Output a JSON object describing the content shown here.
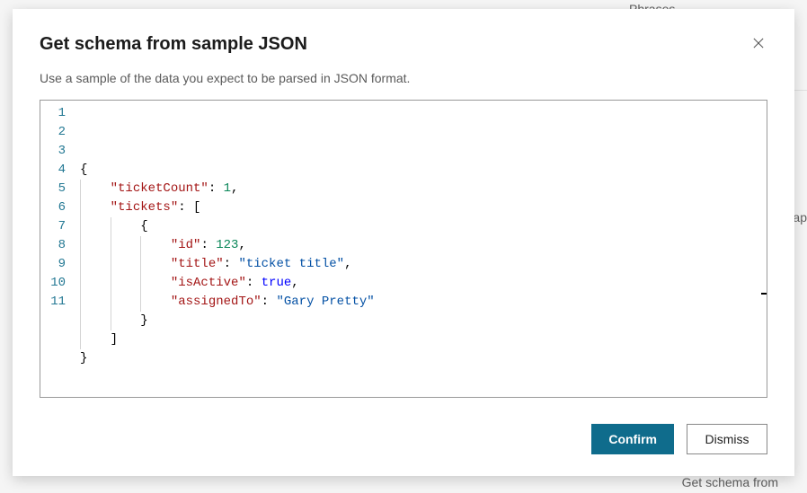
{
  "background": {
    "phrases": "Phrases",
    "ap": "ap",
    "get_schema": "Get schema from"
  },
  "dialog": {
    "title": "Get schema from sample JSON",
    "subtitle": "Use a sample of the data you expect to be parsed in JSON format.",
    "buttons": {
      "confirm": "Confirm",
      "dismiss": "Dismiss"
    }
  },
  "editor": {
    "line_count": 11,
    "sample": {
      "ticketCount": 1,
      "tickets": [
        {
          "id": 123,
          "title": "ticket title",
          "isActive": true,
          "assignedTo": "Gary Pretty"
        }
      ]
    },
    "tokens": [
      [
        {
          "t": "brace",
          "v": "{"
        }
      ],
      [
        {
          "t": "indent",
          "v": 1
        },
        {
          "t": "key",
          "v": "\"ticketCount\""
        },
        {
          "t": "colon",
          "v": ": "
        },
        {
          "t": "num",
          "v": "1"
        },
        {
          "t": "punct",
          "v": ","
        }
      ],
      [
        {
          "t": "indent",
          "v": 1
        },
        {
          "t": "key",
          "v": "\"tickets\""
        },
        {
          "t": "colon",
          "v": ": "
        },
        {
          "t": "punct",
          "v": "["
        }
      ],
      [
        {
          "t": "indent",
          "v": 2
        },
        {
          "t": "brace",
          "v": "{"
        }
      ],
      [
        {
          "t": "indent",
          "v": 3
        },
        {
          "t": "key",
          "v": "\"id\""
        },
        {
          "t": "colon",
          "v": ": "
        },
        {
          "t": "num",
          "v": "123"
        },
        {
          "t": "punct",
          "v": ","
        }
      ],
      [
        {
          "t": "indent",
          "v": 3
        },
        {
          "t": "key",
          "v": "\"title\""
        },
        {
          "t": "colon",
          "v": ": "
        },
        {
          "t": "str",
          "v": "\"ticket title\""
        },
        {
          "t": "punct",
          "v": ","
        }
      ],
      [
        {
          "t": "indent",
          "v": 3
        },
        {
          "t": "key",
          "v": "\"isActive\""
        },
        {
          "t": "colon",
          "v": ": "
        },
        {
          "t": "bool",
          "v": "true"
        },
        {
          "t": "punct",
          "v": ","
        }
      ],
      [
        {
          "t": "indent",
          "v": 3
        },
        {
          "t": "key",
          "v": "\"assignedTo\""
        },
        {
          "t": "colon",
          "v": ": "
        },
        {
          "t": "str",
          "v": "\"Gary Pretty\""
        }
      ],
      [
        {
          "t": "indent",
          "v": 2
        },
        {
          "t": "brace",
          "v": "}"
        }
      ],
      [
        {
          "t": "indent",
          "v": 1
        },
        {
          "t": "punct",
          "v": "]"
        }
      ],
      [
        {
          "t": "brace",
          "v": "}"
        }
      ]
    ]
  }
}
